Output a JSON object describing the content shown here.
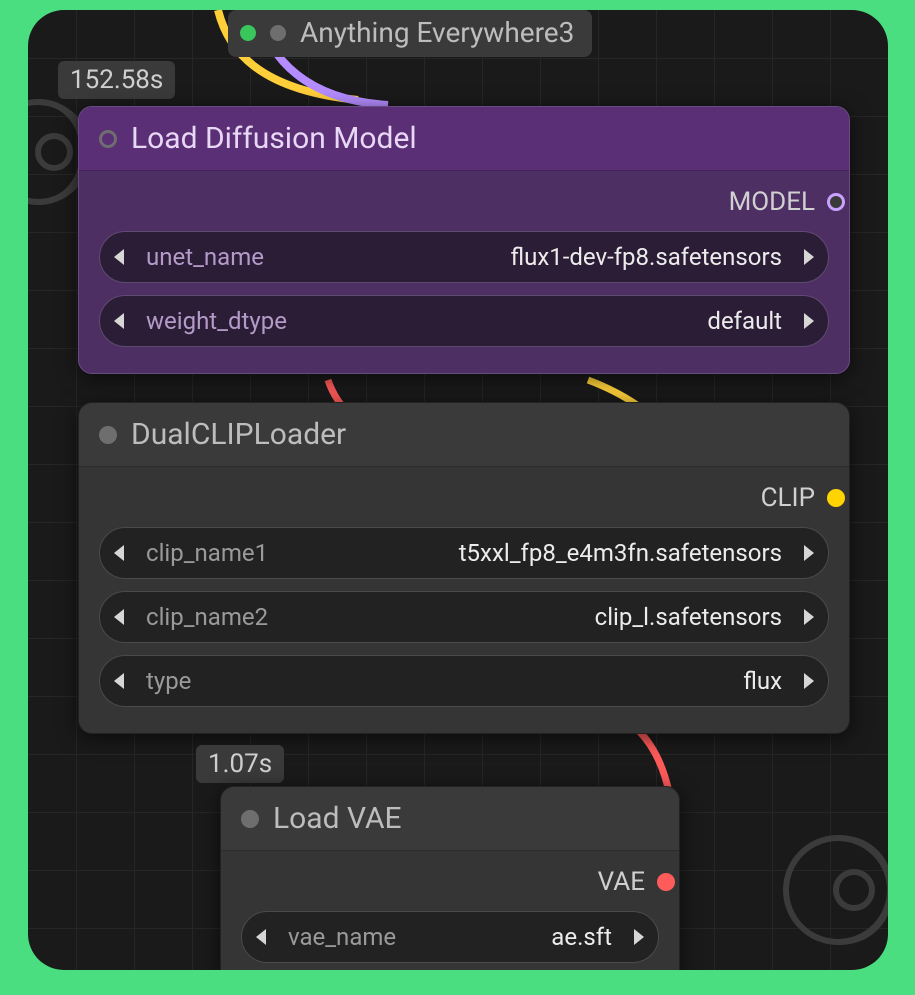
{
  "floating_node": {
    "title": "Anything Everywhere3"
  },
  "timers": {
    "t1": "152.58s",
    "t2": "1.07s"
  },
  "nodes": {
    "diffusion": {
      "title": "Load Diffusion Model",
      "output": "MODEL",
      "fields": {
        "unet_name": {
          "label": "unet_name",
          "value": "flux1-dev-fp8.safetensors"
        },
        "weight_dtype": {
          "label": "weight_dtype",
          "value": "default"
        }
      }
    },
    "dualclip": {
      "title": "DualCLIPLoader",
      "output": "CLIP",
      "fields": {
        "clip_name1": {
          "label": "clip_name1",
          "value": "t5xxl_fp8_e4m3fn.safetensors"
        },
        "clip_name2": {
          "label": "clip_name2",
          "value": "clip_l.safetensors"
        },
        "type": {
          "label": "type",
          "value": "flux"
        }
      }
    },
    "vae": {
      "title": "Load VAE",
      "output": "VAE",
      "fields": {
        "vae_name": {
          "label": "vae_name",
          "value": "ae.sft"
        }
      }
    }
  }
}
